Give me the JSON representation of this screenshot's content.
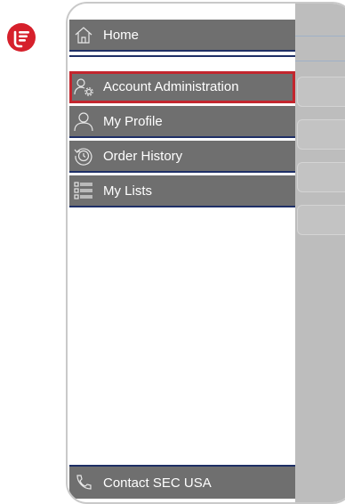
{
  "menu": {
    "items": [
      {
        "label": "Home",
        "icon": "home-icon"
      },
      {
        "label": "Account Administration",
        "icon": "user-gear-icon"
      },
      {
        "label": "My Profile",
        "icon": "user-icon"
      },
      {
        "label": "Order History",
        "icon": "history-icon"
      },
      {
        "label": "My Lists",
        "icon": "list-icon"
      }
    ],
    "footer": {
      "label": "Contact SEC USA",
      "icon": "contact-icon"
    }
  },
  "colors": {
    "brand": "#d6202b",
    "menu_item_bg": "#6f6f6f",
    "menu_divider": "#1e2f66",
    "selection_outline": "#c3262e",
    "background_panel": "#bdbdbd"
  }
}
